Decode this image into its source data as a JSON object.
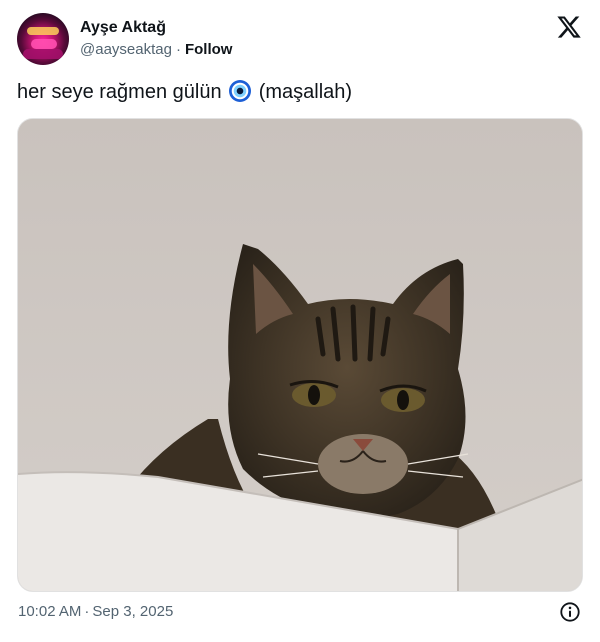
{
  "user": {
    "display_name": "Ayşe Aktağ",
    "handle": "@aayseaktag",
    "separator": "·",
    "follow_label": "Follow"
  },
  "icons": {
    "brand": "x-logo-icon",
    "emoji": "nazar-amulet-emoji-icon",
    "info": "info-icon"
  },
  "tweet": {
    "text_before_emoji": "her seye rağmen gülün",
    "text_after_emoji": "(maşallah)"
  },
  "media": {
    "description_kind": "photo",
    "subject": "tabby cat"
  },
  "meta": {
    "time": "10:02 AM",
    "separator": "·",
    "date": "Sep 3, 2025"
  },
  "colors": {
    "text_primary": "#0f1419",
    "text_secondary": "#536471",
    "background": "#ffffff"
  }
}
